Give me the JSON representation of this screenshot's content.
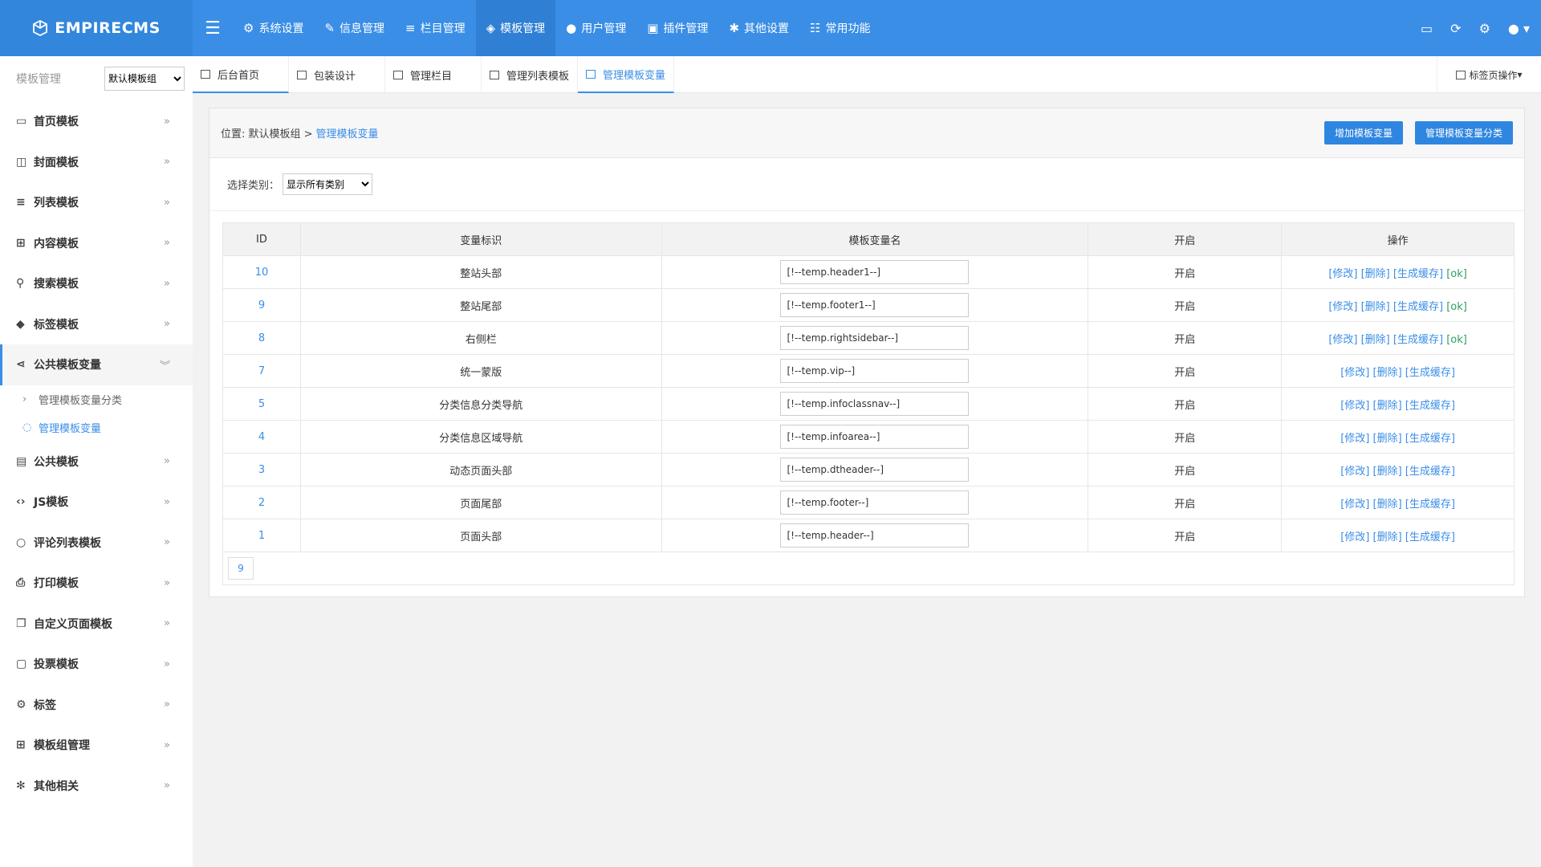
{
  "header": {
    "logo_text": "EMPIRECMS",
    "nav": [
      {
        "label": "系统设置",
        "icon": "gear-icon"
      },
      {
        "label": "信息管理",
        "icon": "edit-icon"
      },
      {
        "label": "栏目管理",
        "icon": "list-icon"
      },
      {
        "label": "模板管理",
        "icon": "layers-icon",
        "active": true
      },
      {
        "label": "用户管理",
        "icon": "user-icon"
      },
      {
        "label": "插件管理",
        "icon": "plugin-icon"
      },
      {
        "label": "其他设置",
        "icon": "wrench-icon"
      },
      {
        "label": "常用功能",
        "icon": "sliders-icon"
      }
    ]
  },
  "sidebar": {
    "title": "模板管理",
    "group_select": "默认模板组",
    "items": [
      {
        "label": "首页模板",
        "icon": "monitor-icon"
      },
      {
        "label": "封面模板",
        "icon": "columns-icon"
      },
      {
        "label": "列表模板",
        "icon": "list-icon"
      },
      {
        "label": "内容模板",
        "icon": "table-icon"
      },
      {
        "label": "搜索模板",
        "icon": "search-icon"
      },
      {
        "label": "标签模板",
        "icon": "tags-icon"
      },
      {
        "label": "公共模板变量",
        "icon": "share-icon",
        "active": true
      },
      {
        "label": "公共模板",
        "icon": "newspaper-icon"
      },
      {
        "label": "JS模板",
        "icon": "code-icon"
      },
      {
        "label": "评论列表模板",
        "icon": "comment-icon"
      },
      {
        "label": "打印模板",
        "icon": "print-icon"
      },
      {
        "label": "自定义页面模板",
        "icon": "copy-icon"
      },
      {
        "label": "投票模板",
        "icon": "chat-icon"
      },
      {
        "label": "标签",
        "icon": "cog-icon"
      },
      {
        "label": "模板组管理",
        "icon": "grid-icon"
      },
      {
        "label": "其他相关",
        "icon": "settings-icon"
      }
    ],
    "sub_items": [
      {
        "label": "管理模板变量分类"
      },
      {
        "label": "管理模板变量"
      }
    ]
  },
  "tabs": [
    {
      "label": "后台首页"
    },
    {
      "label": "包装设计"
    },
    {
      "label": "管理栏目"
    },
    {
      "label": "管理列表模板"
    },
    {
      "label": "管理模板变量",
      "active": true
    }
  ],
  "tab_ops_label": "标签页操作",
  "panel": {
    "breadcrumb_prefix": "位置: 默认模板组 >",
    "breadcrumb_link": "管理模板变量",
    "btn_add": "增加模板变量",
    "btn_manage_class": "管理模板变量分类",
    "filter_label": "选择类别：",
    "filter_select": "显示所有类别",
    "columns": [
      "ID",
      "变量标识",
      "模板变量名",
      "开启",
      "操作"
    ],
    "rows": [
      {
        "id": "10",
        "name": "整站头部",
        "var": "[!--temp.header1--]",
        "enabled": "开启",
        "ok": true
      },
      {
        "id": "9",
        "name": "整站尾部",
        "var": "[!--temp.footer1--]",
        "enabled": "开启",
        "ok": true
      },
      {
        "id": "8",
        "name": "右侧栏",
        "var": "[!--temp.rightsidebar--]",
        "enabled": "开启",
        "ok": true
      },
      {
        "id": "7",
        "name": "统一蒙版",
        "var": "[!--temp.vip--]",
        "enabled": "开启",
        "ok": false
      },
      {
        "id": "5",
        "name": "分类信息分类导航",
        "var": "[!--temp.infoclassnav--]",
        "enabled": "开启",
        "ok": false
      },
      {
        "id": "4",
        "name": "分类信息区域导航",
        "var": "[!--temp.infoarea--]",
        "enabled": "开启",
        "ok": false
      },
      {
        "id": "3",
        "name": "动态页面头部",
        "var": "[!--temp.dtheader--]",
        "enabled": "开启",
        "ok": false
      },
      {
        "id": "2",
        "name": "页面尾部",
        "var": "[!--temp.footer--]",
        "enabled": "开启",
        "ok": false
      },
      {
        "id": "1",
        "name": "页面头部",
        "var": "[!--temp.header--]",
        "enabled": "开启",
        "ok": false
      }
    ],
    "op_labels": {
      "edit": "[修改]",
      "delete": "[删除]",
      "cache": "[生成缓存]",
      "ok": "[ok]"
    },
    "pager": "9"
  },
  "colors": {
    "accent": "#3a8ee6",
    "ok": "#2e9e5e",
    "header_bg": "#3a8ee6"
  }
}
